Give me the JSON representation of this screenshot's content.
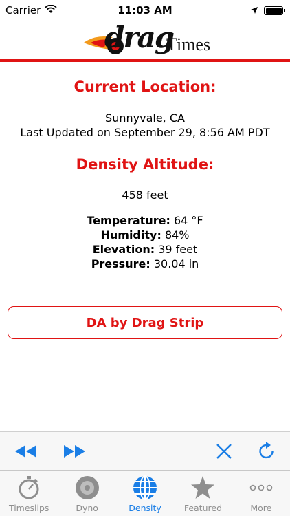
{
  "status_bar": {
    "carrier": "Carrier",
    "time": "11:03 AM"
  },
  "header": {
    "logo_drag": "drag",
    "logo_times": "Times"
  },
  "location": {
    "title": "Current Location:",
    "city": "Sunnyvale, CA",
    "last_updated": "Last Updated on September 29, 8:56 AM PDT"
  },
  "density": {
    "title": "Density Altitude:",
    "value": "458 feet",
    "stats": [
      {
        "label": "Temperature:",
        "value": "64 °F"
      },
      {
        "label": "Humidity:",
        "value": "84%"
      },
      {
        "label": "Elevation:",
        "value": "39 feet"
      },
      {
        "label": "Pressure:",
        "value": "30.04 in"
      }
    ]
  },
  "buttons": {
    "da_by_strip": "DA by Drag Strip"
  },
  "toolbar": {
    "icons": [
      "rewind-icon",
      "fast-forward-icon",
      "close-icon",
      "refresh-icon"
    ]
  },
  "tabs": [
    {
      "label": "Timeslips",
      "icon": "stopwatch-icon",
      "active": false
    },
    {
      "label": "Dyno",
      "icon": "tire-icon",
      "active": false
    },
    {
      "label": "Density",
      "icon": "globe-icon",
      "active": true
    },
    {
      "label": "Featured",
      "icon": "star-icon",
      "active": false
    },
    {
      "label": "More",
      "icon": "more-icon",
      "active": false
    }
  ],
  "colors": {
    "accent_red": "#e01414",
    "ios_blue": "#1a7ee6",
    "tab_inactive": "#8e8e8e"
  }
}
